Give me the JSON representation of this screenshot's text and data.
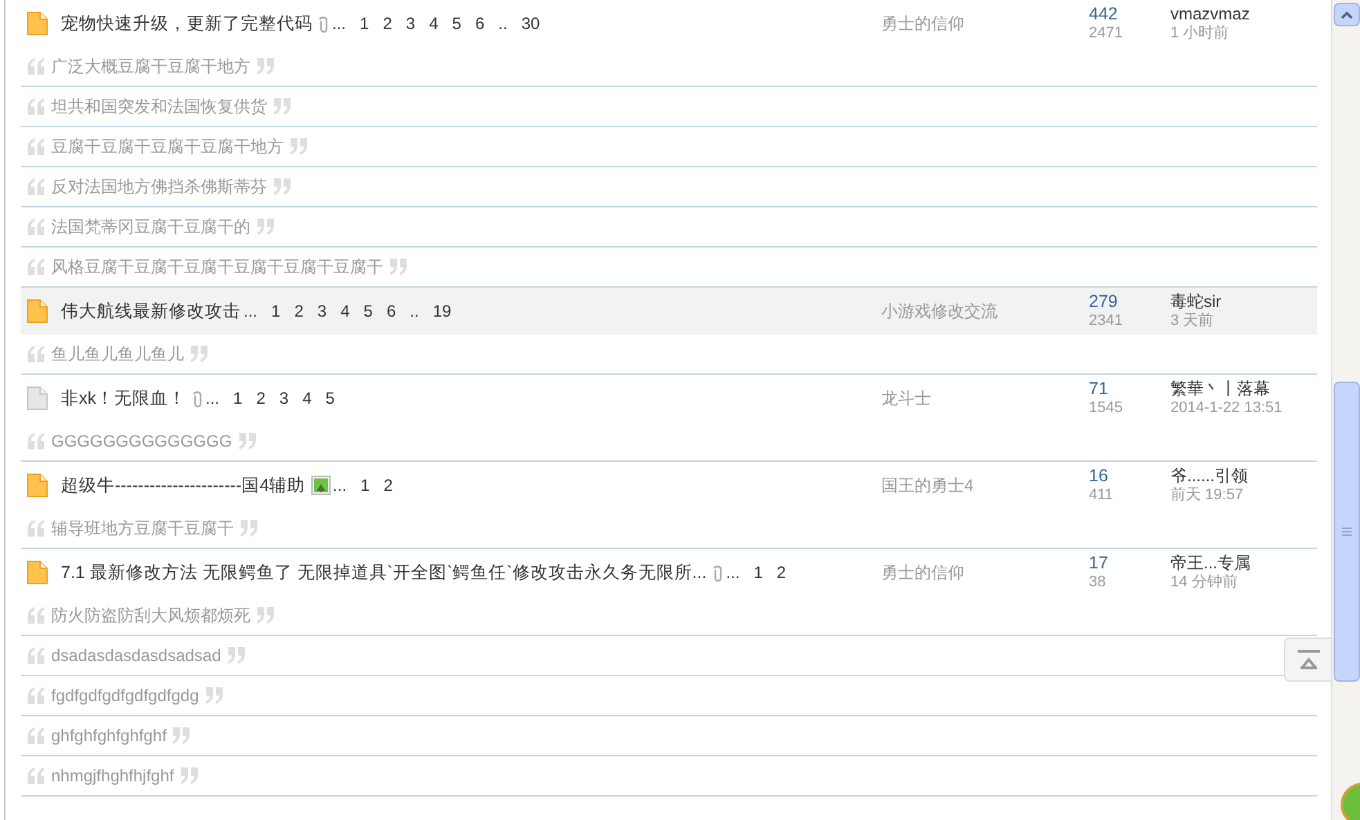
{
  "threads": [
    {
      "kind": "hot",
      "highlighted": false,
      "title": "宠物快速升级，更新了完整代码",
      "clip": true,
      "image": false,
      "pages": [
        "...",
        "1",
        "2",
        "3",
        "4",
        "5",
        "6",
        "..",
        "30"
      ],
      "forum": "勇士的信仰",
      "replies": "442",
      "views": "2471",
      "last_poster": "vmazvmaz",
      "last_time": "1 小时前",
      "quotes": [
        "广泛大概豆腐干豆腐干地方",
        "坦共和国突发和法国恢复供货",
        "豆腐干豆腐干豆腐干豆腐干地方",
        "反对法国地方佛挡杀佛斯蒂芬",
        "法国梵蒂冈豆腐干豆腐干的",
        "风格豆腐干豆腐干豆腐干豆腐干豆腐干豆腐干"
      ]
    },
    {
      "kind": "hot",
      "highlighted": true,
      "title": "伟大航线最新修改攻击",
      "clip": false,
      "image": false,
      "pages": [
        "...",
        "1",
        "2",
        "3",
        "4",
        "5",
        "6",
        "..",
        "19"
      ],
      "forum": "小游戏修改交流",
      "replies": "279",
      "views": "2341",
      "last_poster": "毒蛇sir",
      "last_time": "3 天前",
      "quotes": [
        "鱼儿鱼儿鱼儿鱼儿"
      ]
    },
    {
      "kind": "normal",
      "highlighted": false,
      "title": "非xk！无限血！",
      "clip": true,
      "image": false,
      "pages": [
        "...",
        "1",
        "2",
        "3",
        "4",
        "5"
      ],
      "forum": "龙斗士",
      "replies": "71",
      "views": "1545",
      "last_poster": "繁華丶丨落幕",
      "last_time": "2014-1-22 13:51",
      "quotes": [
        "GGGGGGGGGGGGGG"
      ]
    },
    {
      "kind": "hot",
      "highlighted": false,
      "title": "超级牛----------------------国4辅助",
      "clip": false,
      "image": true,
      "pages": [
        "...",
        "1",
        "2"
      ],
      "forum": "国王的勇士4",
      "replies": "16",
      "views": "411",
      "last_poster": "爷......引领",
      "last_time": "前天 19:57",
      "quotes": [
        "辅导班地方豆腐干豆腐干"
      ]
    },
    {
      "kind": "hot",
      "highlighted": false,
      "title": "7.1 最新修改方法 无限鳄鱼了 无限掉道具`开全图`鳄鱼任`修改攻击永久务无限所...",
      "clip": true,
      "image": false,
      "pages": [
        "...",
        "1",
        "2"
      ],
      "forum": "勇士的信仰",
      "replies": "17",
      "views": "38",
      "last_poster": "帝王...专属",
      "last_time": "14 分钟前",
      "quotes": [
        "防火防盗防刮大风烦都烦死",
        "dsadasdasdasdsadsad",
        "fgdfgdfgdfgdfgdfgdg",
        "ghfghfghfghfghf",
        "nhmgjfhghfhjfghf"
      ]
    }
  ]
}
